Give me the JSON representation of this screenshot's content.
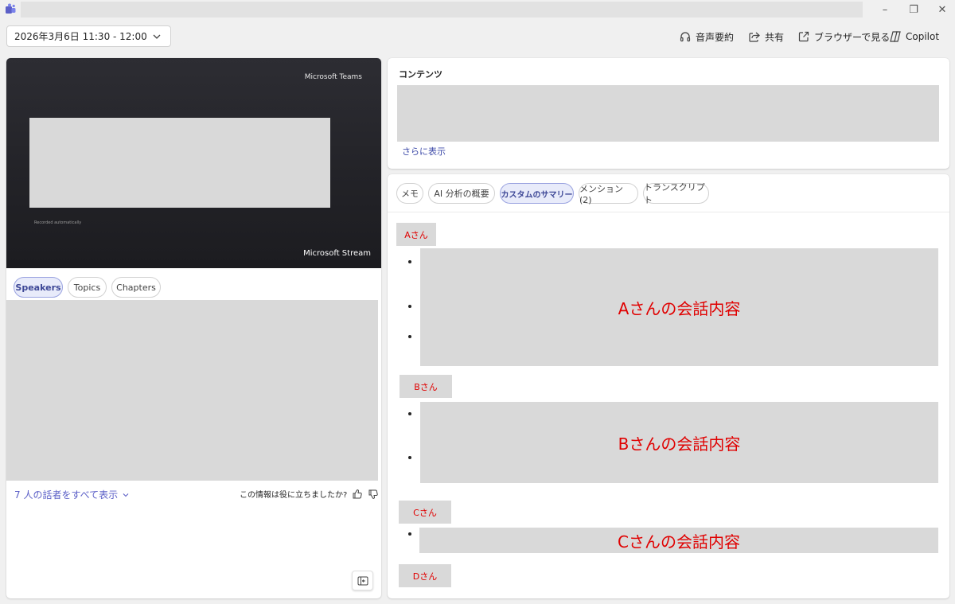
{
  "window": {
    "minimize": "–",
    "maximize": "❐",
    "close": "✕"
  },
  "toolbar": {
    "date_range": "2026年3月6日 11:30 - 12:00",
    "audio_summary": "音声要約",
    "share": "共有",
    "open_browser": "ブラウザーで見る",
    "copilot": "Copilot"
  },
  "video": {
    "top_label": "Microsoft Teams",
    "recorded_note": "Recorded automatically",
    "bottom_label": "Microsoft Stream"
  },
  "left_tabs": [
    "Speakers",
    "Topics",
    "Chapters"
  ],
  "left_footer": {
    "show_all": "7 人の話者をすべて表示",
    "helpful_question": "この情報は役に立ちましたか?"
  },
  "contents": {
    "title": "コンテンツ",
    "show_more": "さらに表示"
  },
  "right_tabs": [
    "メモ",
    "AI 分析の概要",
    "カスタムのサマリー",
    "メンション (2)",
    "トランスクリプト"
  ],
  "active_right_tab": "カスタムのサマリー",
  "summary": {
    "sections": [
      {
        "speaker": "Aさん",
        "content": "Aさんの会話内容",
        "bullets": 3
      },
      {
        "speaker": "Bさん",
        "content": "Bさんの会話内容",
        "bullets": 2
      },
      {
        "speaker": "Cさん",
        "content": "Cさんの会話内容",
        "bullets": 1
      },
      {
        "speaker": "Dさん"
      }
    ]
  },
  "colors": {
    "accent": "#5b5fc7",
    "highlight_text": "#e00000",
    "placeholder": "#d9d9d9"
  }
}
